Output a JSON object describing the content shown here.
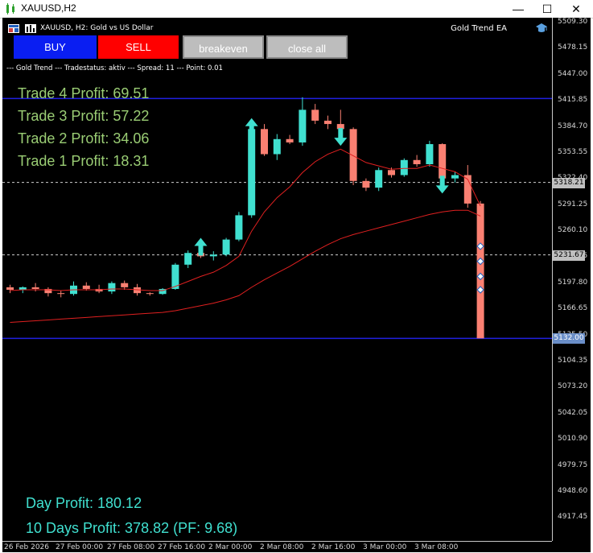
{
  "window": {
    "title": "XAUUSD,H2",
    "minimize_glyph": "—",
    "maximize_glyph": "☐",
    "close_glyph": "✕"
  },
  "chart_header": {
    "symbol_line": "XAUUSD, H2:  Gold vs US Dollar",
    "ea_name": "Gold Trend EA",
    "ea_icon": "graduation-cap-icon"
  },
  "buttons": {
    "buy": "BUY",
    "sell": "SELL",
    "breakeven": "breakeven",
    "close_all": "close all"
  },
  "colors": {
    "buy": "#0a1ef2",
    "sell": "#ff0000",
    "neutral_button": "#bdbdbd",
    "bull_candle": "#40e0d0",
    "bear_candle": "#fa8072",
    "ma": "#e02020",
    "entry_line": "#2020e0",
    "trade_text": "#9acd74",
    "day_text": "#40e0d0"
  },
  "status_line": "--- Gold Trend --- Tradestatus: aktiv --- Spread: 11 --- Point: 0.01",
  "trades": [
    "Trade 4 Profit: 69.51",
    "Trade 3 Profit: 57.22",
    "Trade 2 Profit: 34.06",
    "Trade 1 Profit: 18.31"
  ],
  "summary": {
    "day_profit": "Day Profit: 180.12",
    "ten_days_profit": "10 Days Profit: 378.82 (PF: 9.68)"
  },
  "chart_data": {
    "type": "candlestick",
    "title": "",
    "ylim": [
      4890,
      5515
    ],
    "yticks": [
      "5509.30",
      "5478.15",
      "5447.00",
      "5415.85",
      "5384.70",
      "5353.55",
      "5322.40",
      "5291.25",
      "5260.10",
      "5228.95",
      "5197.80",
      "5166.65",
      "5135.50",
      "5104.35",
      "5073.20",
      "5042.05",
      "5010.90",
      "4979.75",
      "4948.60",
      "4917.45"
    ],
    "xticks": [
      "26 Feb 2026",
      "27 Feb 00:00",
      "27 Feb 08:00",
      "27 Feb 16:00",
      "2 Mar 00:00",
      "2 Mar 08:00",
      "2 Mar 16:00",
      "3 Mar 00:00",
      "3 Mar 08:00"
    ],
    "price_labels": [
      "5318.21",
      "5231.67",
      "5132.00"
    ],
    "levels": {
      "upper_entry": 5418.5,
      "ask_line": 5318.21,
      "bid_line": 5231.67,
      "lower_entry": 5132.0
    },
    "candles": [
      [
        5193,
        5196,
        5186,
        5190
      ],
      [
        5190,
        5194,
        5186,
        5193
      ],
      [
        5193,
        5198,
        5188,
        5191
      ],
      [
        5191,
        5193,
        5182,
        5186
      ],
      [
        5186,
        5189,
        5181,
        5185
      ],
      [
        5185,
        5200,
        5183,
        5195
      ],
      [
        5195,
        5199,
        5189,
        5191
      ],
      [
        5191,
        5196,
        5186,
        5188
      ],
      [
        5188,
        5200,
        5185,
        5198
      ],
      [
        5198,
        5201,
        5190,
        5193
      ],
      [
        5193,
        5197,
        5183,
        5186
      ],
      [
        5186,
        5187,
        5183,
        5185
      ],
      [
        5185,
        5192,
        5184,
        5191
      ],
      [
        5191,
        5222,
        5190,
        5220
      ],
      [
        5220,
        5237,
        5216,
        5234
      ],
      [
        5234,
        5240,
        5228,
        5230
      ],
      [
        5230,
        5236,
        5225,
        5232
      ],
      [
        5232,
        5252,
        5230,
        5250
      ],
      [
        5250,
        5283,
        5248,
        5279
      ],
      [
        5279,
        5390,
        5276,
        5382
      ],
      [
        5382,
        5388,
        5350,
        5352
      ],
      [
        5352,
        5376,
        5345,
        5370
      ],
      [
        5370,
        5375,
        5364,
        5366
      ],
      [
        5366,
        5420,
        5362,
        5405
      ],
      [
        5405,
        5412,
        5388,
        5392
      ],
      [
        5392,
        5398,
        5382,
        5388
      ],
      [
        5388,
        5405,
        5375,
        5382
      ],
      [
        5382,
        5384,
        5315,
        5320
      ],
      [
        5320,
        5323,
        5308,
        5312
      ],
      [
        5312,
        5336,
        5308,
        5333
      ],
      [
        5333,
        5336,
        5324,
        5327
      ],
      [
        5327,
        5347,
        5325,
        5345
      ],
      [
        5345,
        5351,
        5337,
        5340
      ],
      [
        5340,
        5368,
        5337,
        5364
      ],
      [
        5364,
        5365,
        5320,
        5323
      ],
      [
        5323,
        5331,
        5318,
        5327
      ],
      [
        5327,
        5339,
        5288,
        5293
      ],
      [
        5293,
        5296,
        5146,
        5132
      ]
    ],
    "ma_fast": [
      5189,
      5190,
      5190,
      5190,
      5189,
      5190,
      5190,
      5190,
      5191,
      5191,
      5190,
      5189,
      5189,
      5194,
      5200,
      5206,
      5211,
      5219,
      5230,
      5260,
      5283,
      5300,
      5313,
      5330,
      5343,
      5352,
      5358,
      5350,
      5342,
      5338,
      5334,
      5335,
      5335,
      5339,
      5335,
      5331,
      5322,
      5290
    ],
    "ma_slow": [
      5151,
      5152,
      5153,
      5154,
      5155,
      5156,
      5157,
      5158,
      5159,
      5160,
      5161,
      5162,
      5163,
      5165,
      5168,
      5171,
      5174,
      5178,
      5183,
      5193,
      5202,
      5210,
      5218,
      5227,
      5236,
      5244,
      5251,
      5256,
      5260,
      5264,
      5268,
      5272,
      5276,
      5280,
      5283,
      5285,
      5285,
      5278
    ]
  }
}
